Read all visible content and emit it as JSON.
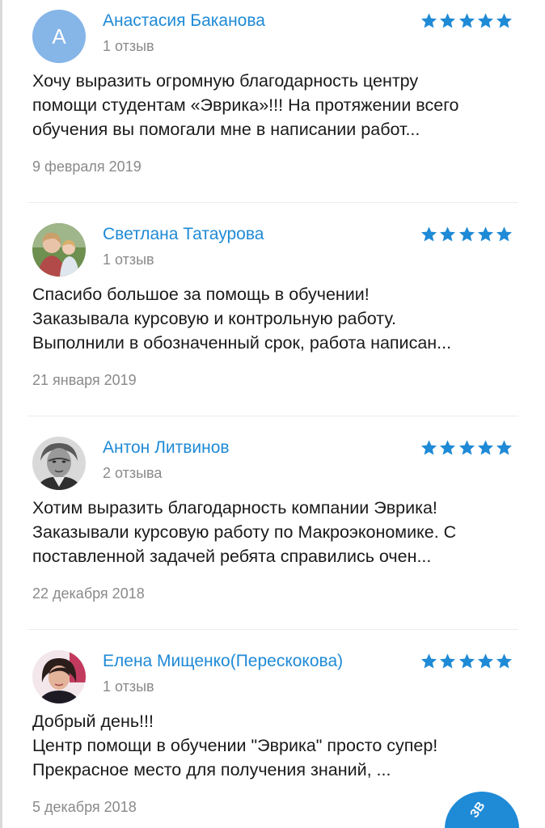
{
  "colors": {
    "accent": "#1f8ad6",
    "star": "#1f8ad6",
    "muted_text": "#8a8a8a",
    "body_text": "#1a1a1a",
    "avatar_placeholder": "#86b5e8"
  },
  "reviews": [
    {
      "avatar_letter": "А",
      "author": "Анастасия Баканова",
      "review_count": "1 отзыв",
      "rating": 5,
      "text_lines": [
        "Хочу выразить огромную благодарность центру",
        "помощи студентам «Эврика»!!! На протяжении всего",
        "обучения вы помогали мне в написании работ..."
      ],
      "date": "9 февраля 2019"
    },
    {
      "avatar_letter": "",
      "author": "Светлана Татаурова",
      "review_count": "1 отзыв",
      "rating": 5,
      "text_lines": [
        "Спасибо большое за помощь в обучении!",
        "Заказывала курсовую и контрольную работу.",
        "Выполнили в обозначенный срок, работа написан..."
      ],
      "date": "21 января 2019"
    },
    {
      "avatar_letter": "",
      "author": "Антон Литвинов",
      "review_count": "2 отзыва",
      "rating": 5,
      "text_lines": [
        "Хотим выразить благодарность компании Эврика!",
        "Заказывали курсовую работу по Макроэкономике. С",
        "поставленной задачей ребята справились очен..."
      ],
      "date": "22 декабря 2018"
    },
    {
      "avatar_letter": "",
      "author": "Елена Мищенко(Перескокова)",
      "review_count": "1 отзыв",
      "rating": 5,
      "text_lines": [
        "Добрый день!!!",
        "Центр помощи в обучении \"Эврика\" просто супер!",
        "Прекрасное место для получения знаний, ..."
      ],
      "date": "5 декабря 2018"
    }
  ],
  "fab": {
    "label": "ЗВ"
  }
}
